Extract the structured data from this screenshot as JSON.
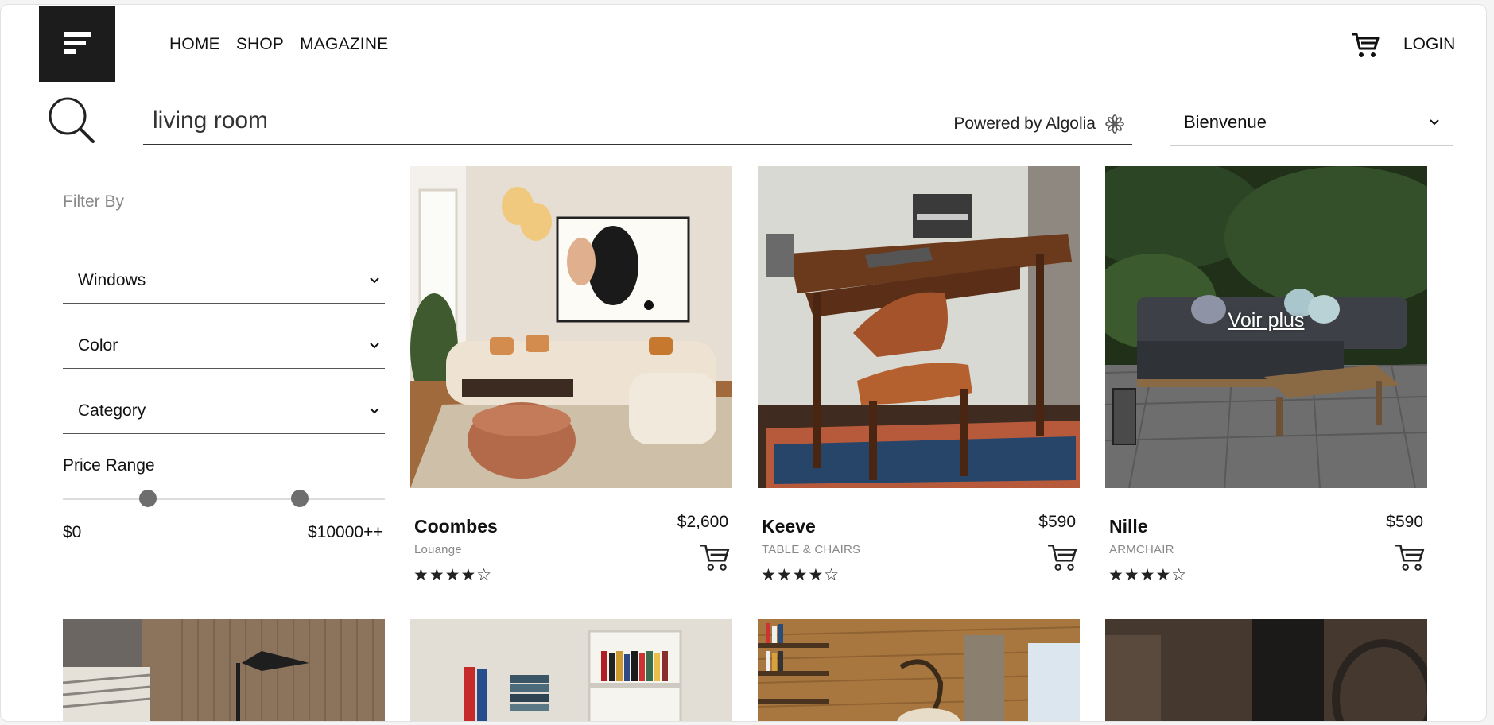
{
  "nav": {
    "home": "HOME",
    "shop": "SHOP",
    "magazine": "MAGAZINE",
    "login": "LOGIN"
  },
  "search": {
    "value": "living room",
    "powered_by": "Powered by Algolia"
  },
  "language": {
    "selected": "Bienvenue"
  },
  "filters": {
    "title": "Filter By",
    "windows": "Windows",
    "color": "Color",
    "category": "Category",
    "price_range_label": "Price Range",
    "price_min": "$0",
    "price_max": "$10000++",
    "slider_low_fraction": 0.25,
    "slider_high_fraction": 0.75
  },
  "products": [
    {
      "name": "Coombes",
      "category": "Louange",
      "price": "$2,600",
      "stars": "★★★★☆",
      "rating": 4
    },
    {
      "name": "Keeve",
      "category": "TABLE & CHAIRS",
      "price": "$590",
      "stars": "★★★★☆",
      "rating": 4
    },
    {
      "name": "Nille",
      "category": "ARMCHAIR",
      "price": "$590",
      "stars": "★★★★☆",
      "rating": 4,
      "hover_label": "Voir plus"
    }
  ],
  "colors": {
    "logo_bg": "#1c1c1c",
    "slider_thumb": "#6e6e6e"
  }
}
